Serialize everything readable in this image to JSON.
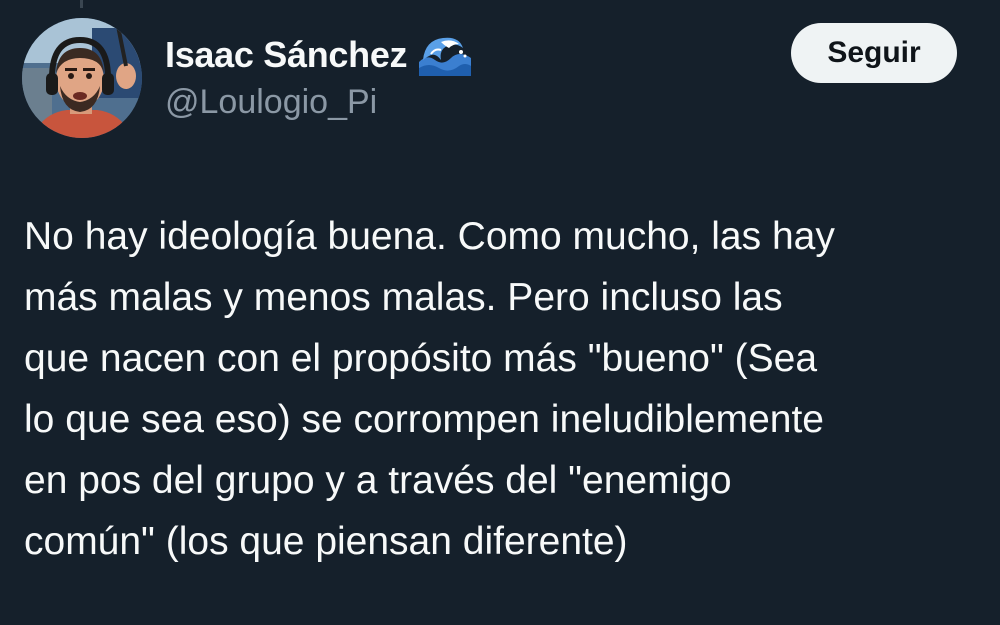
{
  "author": {
    "display_name": "Isaac Sánchez",
    "handle": "@Loulogio_Pi",
    "emoji_icon": "water-wave-icon"
  },
  "actions": {
    "follow_label": "Seguir"
  },
  "tweet": {
    "lines": [
      "No hay ideología buena. Como mucho, las hay",
      "más malas y menos malas. Pero incluso las",
      "que nacen con el propósito más \"bueno\" (Sea",
      "lo que sea eso) se corrompen ineludiblemente",
      "en pos del grupo y a través del \"enemigo",
      "común\" (los que piensan diferente)"
    ]
  },
  "colors": {
    "background": "#15202b",
    "text_primary": "#f7f9f9",
    "text_secondary": "#8b98a5",
    "button_bg": "#eff3f4",
    "button_text": "#0f1419"
  }
}
